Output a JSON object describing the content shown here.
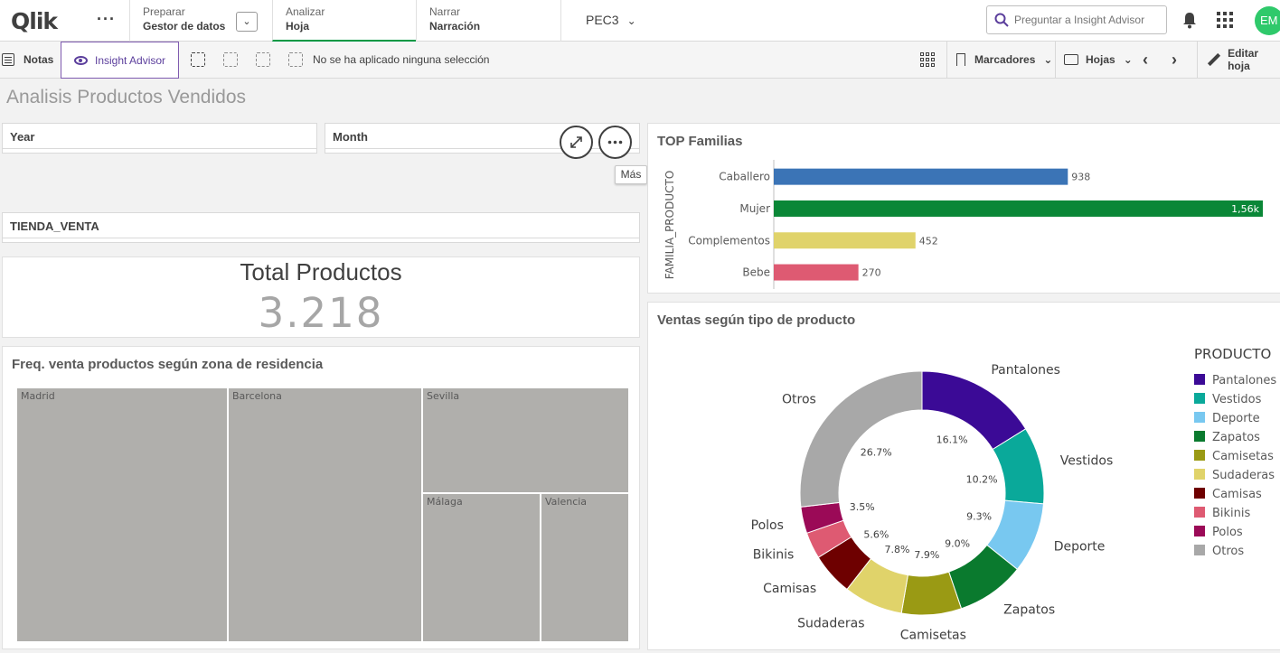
{
  "topbar": {
    "logo": "Qlik",
    "prepare": {
      "small": "Preparar",
      "big": "Gestor de datos"
    },
    "analyze": {
      "small": "Analizar",
      "big": "Hoja"
    },
    "narrate": {
      "small": "Narrar",
      "big": "Narración"
    },
    "app_name": "PEC3",
    "search_placeholder": "Preguntar a Insight Advisor",
    "avatar": "EM"
  },
  "toolbar": {
    "notes": "Notas",
    "insight": "Insight Advisor",
    "no_selection": "No se ha aplicado ninguna selección",
    "bookmarks": "Marcadores",
    "sheets": "Hojas",
    "edit": "Editar hoja"
  },
  "sheet": {
    "title": "Analisis Productos Vendidos",
    "filters": {
      "year": "Year",
      "month": "Month",
      "store": "TIENDA_VENTA"
    },
    "tooltip": "Más",
    "kpi": {
      "title": "Total Productos",
      "value": "3.218"
    }
  },
  "treemap": {
    "title": "Freq. venta productos según zona de residencia",
    "cells": [
      "Madrid",
      "Barcelona",
      "Sevilla",
      "Málaga",
      "Valencia"
    ],
    "color": "#b0afac"
  },
  "chart_data": [
    {
      "type": "bar",
      "title": "TOP Familias",
      "ylabel": "FAMILIA_PRODUCTO",
      "orientation": "horizontal",
      "categories": [
        "Caballero",
        "Mujer",
        "Complementos",
        "Bebe"
      ],
      "values": [
        938,
        1560,
        452,
        270
      ],
      "value_labels": [
        "938",
        "1,56k",
        "452",
        "270"
      ],
      "colors": [
        "#3b74b6",
        "#0a8737",
        "#e0d36a",
        "#de5a72"
      ]
    },
    {
      "type": "pie",
      "title": "Ventas según tipo de producto",
      "legend_title": "PRODUCTO",
      "legend_position": "right",
      "categories": [
        "Pantalones",
        "Vestidos",
        "Deporte",
        "Zapatos",
        "Camisetas",
        "Sudaderas",
        "Camisas",
        "Bikinis",
        "Polos",
        "Otros"
      ],
      "values": [
        16.1,
        10.2,
        9.3,
        9.0,
        7.9,
        7.8,
        5.6,
        3.5,
        3.5,
        26.7
      ],
      "value_labels": [
        "16.1%",
        "10.2%",
        "9.3%",
        "9.0%",
        "7.9%",
        "7.8%",
        "5.6%",
        "",
        "3.5%",
        "26.7%"
      ],
      "colors": [
        "#3b0a96",
        "#0aa99a",
        "#78c8f0",
        "#0a7a2e",
        "#9a9a14",
        "#e0d36a",
        "#6e0000",
        "#de5a72",
        "#9b0a57",
        "#a8a8a8"
      ]
    }
  ]
}
